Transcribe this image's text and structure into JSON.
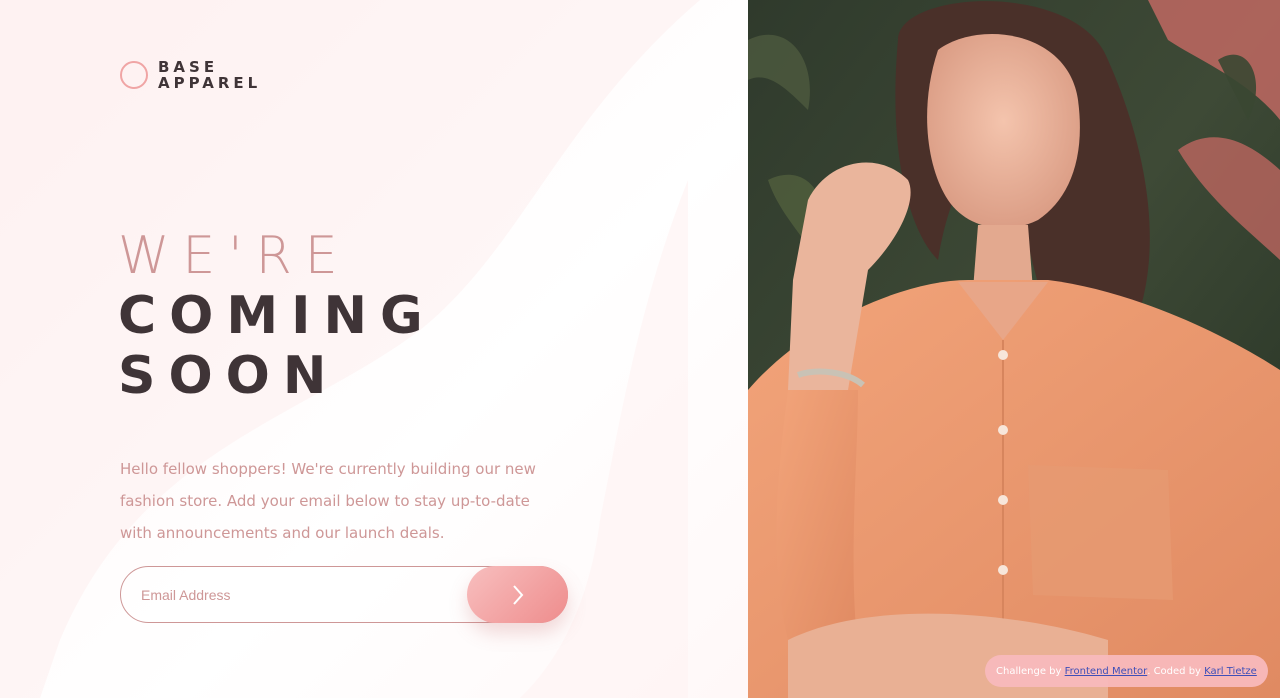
{
  "logo": {
    "line1": "BASE",
    "line2": "APPAREL"
  },
  "hero": {
    "line1": "WE'RE",
    "line2": "COMING",
    "line3": "SOON",
    "intro": "Hello fellow shoppers! We're currently building our new fashion store. Add your email below to stay up-to-date with announcements and our launch deals."
  },
  "form": {
    "email_placeholder": "Email Address",
    "email_value": "",
    "submit_icon": "chevron-right-icon"
  },
  "attribution": {
    "prefix": "Challenge by",
    "link1": "Frontend Mentor",
    "middle": ". Coded by",
    "link2": "Karl Tietze"
  },
  "colors": {
    "primary_pink": "#ce9797",
    "dark": "#3f3437",
    "gradient_start": "#f8bfbf",
    "gradient_end": "#ee8c8c"
  }
}
